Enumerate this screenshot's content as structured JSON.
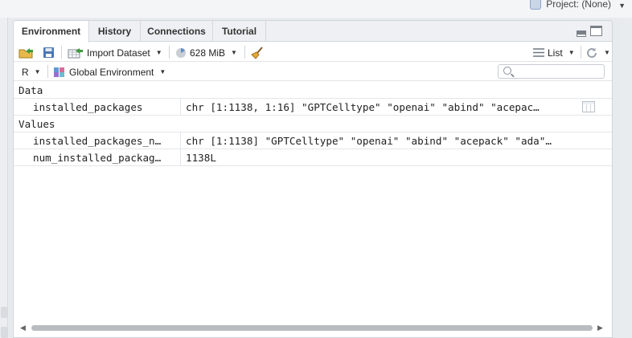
{
  "project": {
    "label": "Project: (None)"
  },
  "tabs": [
    {
      "label": "Environment",
      "active": true
    },
    {
      "label": "History",
      "active": false
    },
    {
      "label": "Connections",
      "active": false
    },
    {
      "label": "Tutorial",
      "active": false
    }
  ],
  "toolbar": {
    "import_label": "Import Dataset",
    "memory_label": "628 MiB",
    "view_label": "List"
  },
  "env_bar": {
    "language": "R",
    "scope": "Global Environment",
    "search_placeholder": ""
  },
  "sections": [
    {
      "label": "Data",
      "rows": [
        {
          "name": "installed_packages",
          "value": "chr [1:1138, 1:16] \"GPTCelltype\" \"openai\" \"abind\" \"acepac…",
          "has_grid_icon": true
        }
      ]
    },
    {
      "label": "Values",
      "rows": [
        {
          "name": "installed_packages_n…",
          "value": "chr [1:1138] \"GPTCelltype\" \"openai\" \"abind\" \"acepack\" \"ada\"…",
          "has_grid_icon": false
        },
        {
          "name": "num_installed_packag…",
          "value": "1138L",
          "has_grid_icon": false
        }
      ]
    }
  ],
  "colors": {
    "accent": "#4a78b5",
    "border": "#cfd3d8",
    "tab_bg": "#eef0f3"
  },
  "icons": [
    "project-cube-icon",
    "load-workspace-icon",
    "save-workspace-icon",
    "import-dataset-icon",
    "memory-pie-icon",
    "broom-icon",
    "list-view-icon",
    "refresh-icon",
    "r-logo-icon",
    "search-icon",
    "grid-view-icon"
  ]
}
